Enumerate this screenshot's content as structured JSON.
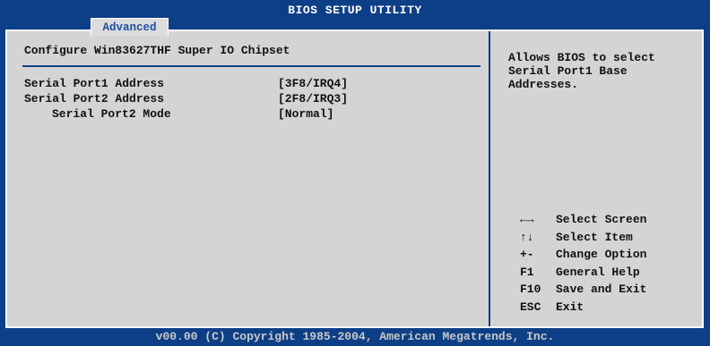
{
  "window": {
    "title": "BIOS SETUP UTILITY",
    "active_tab": "Advanced"
  },
  "main": {
    "heading": "Configure Win83627THF Super IO Chipset",
    "settings": [
      {
        "label": "Serial Port1 Address",
        "value": "[3F8/IRQ4]"
      },
      {
        "label": "Serial Port2 Address",
        "value": "[2F8/IRQ3]"
      },
      {
        "label": "Serial Port2 Mode",
        "value": "[Normal]"
      }
    ]
  },
  "help": {
    "text": "Allows BIOS to select Serial Port1 Base Addresses.",
    "keys": [
      {
        "key": "←→",
        "icon": "left-right-arrows-icon",
        "desc": "Select Screen"
      },
      {
        "key": "↑↓",
        "icon": "up-down-arrows-icon",
        "desc": "Select Item"
      },
      {
        "key": "+-",
        "desc": "Change Option"
      },
      {
        "key": "F1",
        "desc": "General Help"
      },
      {
        "key": "F10",
        "desc": "Save and Exit"
      },
      {
        "key": "ESC",
        "desc": "Exit"
      }
    ]
  },
  "footer": {
    "copyright": "v00.00 (C) Copyright 1985-2004, American Megatrends, Inc."
  },
  "colors": {
    "background": "#0d3f86",
    "panel": "#d4d4d4",
    "tab": "#dcdcdc",
    "text": "#111111",
    "title_text": "#ffffff"
  }
}
